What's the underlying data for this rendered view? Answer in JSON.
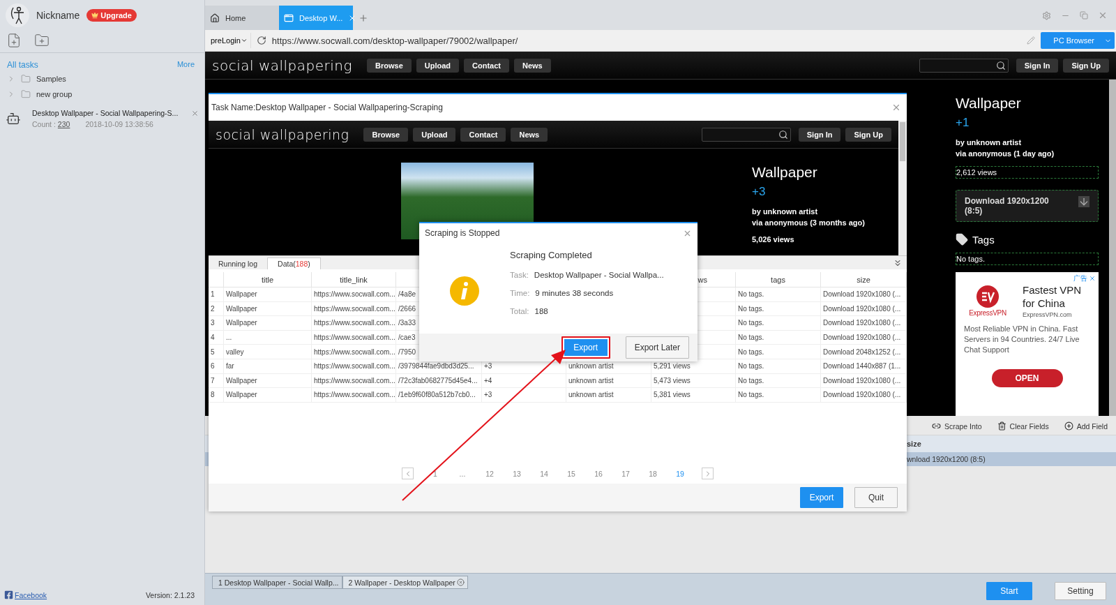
{
  "sidebar": {
    "user": {
      "name": "Nickname",
      "badge": "Upgrade"
    },
    "section_title": "All tasks",
    "more_link": "More",
    "groups": [
      {
        "label": "Samples",
        "expanded": false
      },
      {
        "label": "new group",
        "expanded": false
      }
    ],
    "tasks": [
      {
        "title": "Desktop Wallpaper - Social Wallpapering-S...",
        "count_label": "Count :",
        "count": "230",
        "date": "2018-10-09 13:38:56"
      }
    ],
    "footer": {
      "link": "Facebook",
      "version": "Version: 2.1.23"
    }
  },
  "browser": {
    "tabs": [
      {
        "label": "Home",
        "kind": "home",
        "selected": false
      },
      {
        "label": "Desktop W...",
        "kind": "page",
        "selected": true
      }
    ],
    "login_menu": "preLogin",
    "url": "https://www.socwall.com/desktop-wallpaper/79002/wallpaper/",
    "mode_button": "PC Browser"
  },
  "site": {
    "logo": "social wallpapering",
    "nav": [
      "Browse",
      "Upload",
      "Contact",
      "News"
    ],
    "account": [
      "Sign In",
      "Sign Up"
    ],
    "wallpaper": {
      "title": "Wallpaper",
      "score": "+1",
      "by": "by unknown artist",
      "via": "via anonymous (1 day ago)",
      "views": "2,612 views",
      "download": "Download 1920x1200 (8:5)",
      "tags_title": "Tags",
      "tags": "No tags."
    },
    "ad": {
      "label": "广告",
      "brand": "ExpressVPN",
      "headline": "Fastest VPN for China",
      "domain": "ExpressVPN.com",
      "body": "Most Reliable VPN in China. Fast Servers in 94 Countries. 24/7 Live Chat Support",
      "button": "OPEN"
    }
  },
  "field_panel": {
    "actions": [
      {
        "label": "Scrape Into",
        "kind": "link"
      },
      {
        "label": "Clear Fields",
        "kind": "trash"
      },
      {
        "label": "Add Field",
        "kind": "add"
      }
    ],
    "column": "size",
    "row": {
      "text": "wnload 1920x1200 (8:5)",
      "selected": true
    }
  },
  "task_dialog": {
    "title": "Task Name:Desktop Wallpaper - Social Wallpapering-Scraping",
    "site": {
      "logo": "social wallpapering",
      "nav": [
        "Browse",
        "Upload",
        "Contact",
        "News"
      ],
      "account": [
        "Sign In",
        "Sign Up"
      ],
      "wallpaper": {
        "title": "Wallpaper",
        "score": "+3",
        "by": "by unknown artist",
        "via": "via anonymous (3 months ago)",
        "views": "5,026 views"
      }
    },
    "data_tabs": [
      {
        "label": "Running log",
        "selected": false
      },
      {
        "label": "Data(",
        "count": "188",
        "suffix": ")",
        "selected": true
      }
    ],
    "table": {
      "columns": [
        "",
        "title",
        "title_link",
        "",
        "",
        "",
        "ws",
        "tags",
        "size"
      ],
      "rows": [
        {
          "cells": [
            "1",
            "Wallpaper",
            "https://www.socwall.com...",
            "/4a8e",
            "",
            "",
            "",
            "No tags.",
            "Download 1920x1080 (..."
          ]
        },
        {
          "cells": [
            "2",
            "Wallpaper",
            "https://www.socwall.com...",
            "/2666",
            "",
            "",
            "",
            "No tags.",
            "Download 1920x1080 (..."
          ]
        },
        {
          "cells": [
            "3",
            "Wallpaper",
            "https://www.socwall.com...",
            "/3a33",
            "",
            "",
            "",
            "No tags.",
            "Download 1920x1080 (..."
          ]
        },
        {
          "cells": [
            "4",
            "...",
            "https://www.socwall.com...",
            "/cae3",
            "",
            "",
            "",
            "No tags.",
            "Download 1920x1080 (..."
          ]
        },
        {
          "cells": [
            "5",
            "valley",
            "https://www.socwall.com...",
            "/7950",
            "",
            "",
            "",
            "No tags.",
            "Download 2048x1252 (..."
          ]
        },
        {
          "cells": [
            "6",
            "far",
            "https://www.socwall.com...",
            "/3979844fae9dbd3d25...",
            "+3",
            "unknown artist",
            "5,291 views",
            "No tags.",
            "Download 1440x887 (1..."
          ]
        },
        {
          "cells": [
            "7",
            "Wallpaper",
            "https://www.socwall.com...",
            "/72c3fab0682775d45e4...",
            "+4",
            "unknown artist",
            "5,473 views",
            "No tags.",
            "Download 1920x1080 (..."
          ]
        },
        {
          "cells": [
            "8",
            "Wallpaper",
            "https://www.socwall.com...",
            "/1eb9f60f80a512b7cb0...",
            "+3",
            "unknown artist",
            "5,381 views",
            "No tags.",
            "Download 1920x1080 (..."
          ]
        }
      ]
    },
    "pagination": [
      {
        "label": "1",
        "selected": false
      },
      {
        "label": "...",
        "selected": false
      },
      {
        "label": "12",
        "selected": false
      },
      {
        "label": "13",
        "selected": false
      },
      {
        "label": "14",
        "selected": false
      },
      {
        "label": "15",
        "selected": false
      },
      {
        "label": "16",
        "selected": false
      },
      {
        "label": "17",
        "selected": false
      },
      {
        "label": "18",
        "selected": false
      },
      {
        "label": "19",
        "selected": true
      }
    ],
    "buttons": [
      {
        "label": "Export",
        "kind": "primary"
      },
      {
        "label": "Quit",
        "kind": "default"
      }
    ]
  },
  "completion_dialog": {
    "title": "Scraping is Stopped",
    "heading": "Scraping Completed",
    "fields": [
      {
        "label": "Task:",
        "value": "Desktop Wallpaper - Social Wallpa..."
      },
      {
        "label": "Time:",
        "value": "9 minutes 38 seconds"
      },
      {
        "label": "Total:",
        "value": "188"
      }
    ],
    "buttons": [
      {
        "label": "Export",
        "kind": "primary",
        "highlighted": true
      },
      {
        "label": "Export Later",
        "kind": "default",
        "highlighted": false
      }
    ]
  },
  "bottom_bar": {
    "tabs": [
      {
        "label": "1 Desktop Wallpaper - Social Wallp...",
        "selected": false,
        "closable": false
      },
      {
        "label": "2 Wallpaper - Desktop Wallpaper",
        "selected": true,
        "closable": true
      }
    ],
    "buttons": [
      {
        "label": "Start",
        "kind": "primary"
      },
      {
        "label": "Setting",
        "kind": "default"
      }
    ]
  }
}
